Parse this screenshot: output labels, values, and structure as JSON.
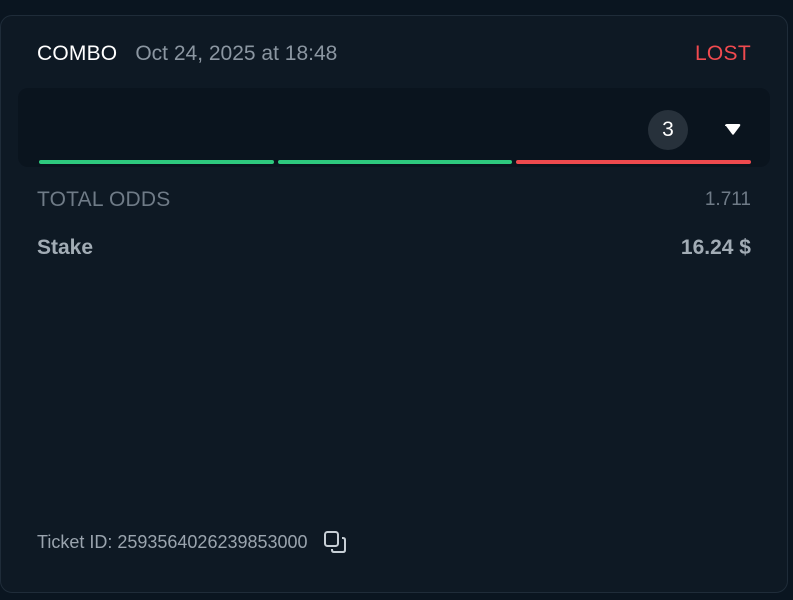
{
  "bet": {
    "type": "COMBO",
    "date": "Oct 24, 2025 at 18:48",
    "status": "LOST"
  },
  "legs": {
    "count": "3",
    "results": [
      "won",
      "won",
      "lost"
    ]
  },
  "colors": {
    "won": "#2ec97e",
    "lost": "#ee4a4e",
    "status_lost": "#f04a4f"
  },
  "summary": {
    "total_odds_label": "TOTAL ODDS",
    "total_odds_value": "1.711",
    "stake_label": "Stake",
    "stake_value": "16.24 $"
  },
  "ticket": {
    "text": "Ticket ID: 2593564026239853000"
  },
  "icons": {
    "expand": "caret-down-icon",
    "copy": "copy-icon"
  }
}
